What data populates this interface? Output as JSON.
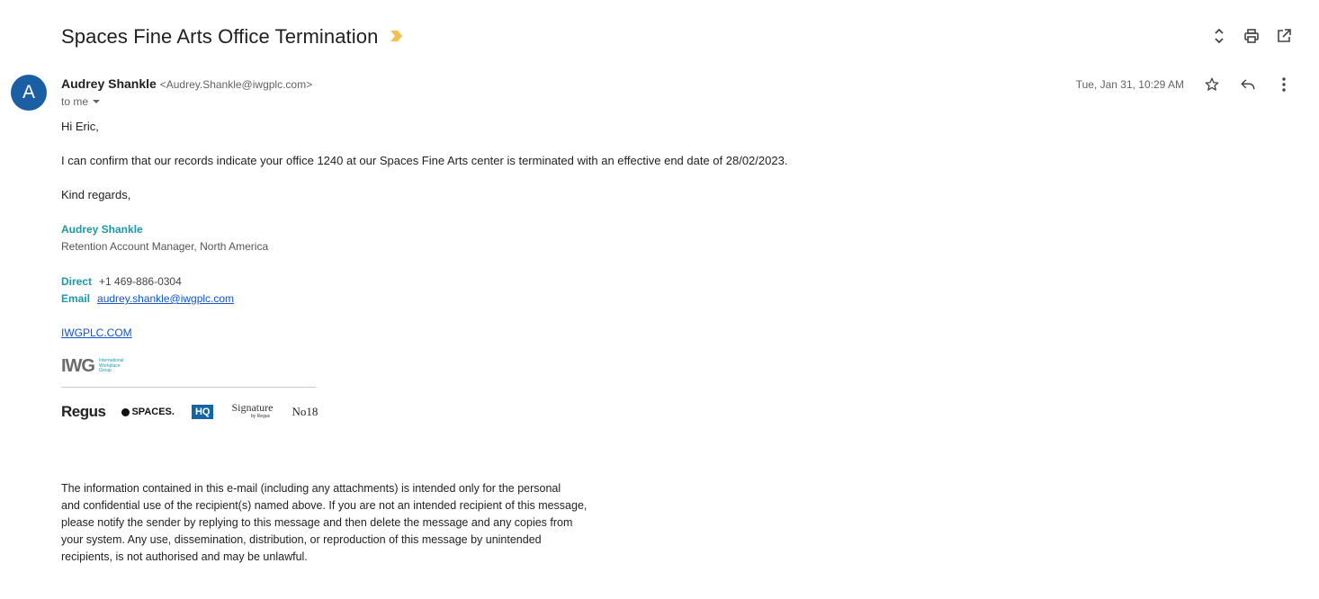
{
  "subject": "Spaces Fine Arts Office Termination",
  "sender": {
    "avatar_letter": "A",
    "name": "Audrey Shankle",
    "email": "<Audrey.Shankle@iwgplc.com>",
    "to_label": "to me",
    "date": "Tue, Jan 31, 10:29 AM"
  },
  "body": {
    "greeting": "Hi Eric,",
    "paragraph": "I can confirm that our records indicate your office 1240 at our Spaces Fine Arts center is terminated with an effective end date of 28/02/2023.",
    "closing": "Kind regards,"
  },
  "signature": {
    "name": "Audrey Shankle",
    "title": "Retention Account Manager, North America",
    "direct_label": "Direct",
    "direct_value": "+1 469-886-0304",
    "email_label": "Email",
    "email_value": "audrey.shankle@iwgplc.com",
    "website": "IWGPLC.COM",
    "iwg_logo_text": "IWG",
    "iwg_logo_sub": [
      "International",
      "Workplace",
      "Group"
    ],
    "brands": [
      "Regus",
      "SPACES.",
      "HQ",
      "Signature",
      "No18"
    ],
    "signature_sub": "by Regus"
  },
  "disclaimer": [
    "The information contained in this e-mail (including any attachments) is intended only for the personal",
    "and confidential use of the recipient(s) named above. If you are not an intended recipient of this message,",
    "please notify the sender by replying to this message and then delete the message and any copies from",
    "your system. Any use, dissemination, distribution, or reproduction of this message by unintended",
    "recipients, is not authorised and may be unlawful."
  ],
  "icons": {
    "importance": "importance-marker-icon",
    "expand": "expand-collapse-icon",
    "print": "print-icon",
    "new_window": "open-in-new-window-icon",
    "star": "star-icon",
    "reply": "reply-icon",
    "more": "more-vertical-icon",
    "dropdown": "dropdown-arrow-icon"
  },
  "colors": {
    "avatar": "#1a5fa3",
    "signature_accent": "#1a9aa8",
    "link": "#1155cc",
    "importance": "#f2c14e",
    "hq_badge": "#1565a6"
  }
}
